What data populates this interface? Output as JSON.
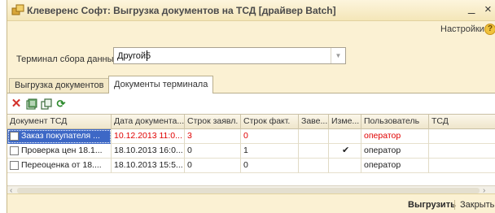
{
  "window": {
    "title": "Клеверенс Софт: Выгрузка документов на ТСД [драйвер Batch]",
    "minimize_glyph": "_",
    "maximize_glyph": "□",
    "close_glyph": "×",
    "settings_label": "Настройки",
    "help_glyph": "?"
  },
  "terminal": {
    "label": "Терминал сбора данных:",
    "value": "Другой5"
  },
  "tabs": [
    {
      "label": "Выгрузка документов",
      "active": false
    },
    {
      "label": "Документы терминала",
      "active": true
    }
  ],
  "toolbar": {
    "icons": [
      "delete-icon",
      "edit-icon",
      "copy-icon",
      "refresh-icon"
    ]
  },
  "table": {
    "columns": [
      "Документ ТСД",
      "Дата документа...",
      "Строк заявл.",
      "Строк факт.",
      "Заве...",
      "Изме...",
      "Пользователь",
      "ТСД"
    ],
    "rows": [
      {
        "doc": "Заказ покупателя ...",
        "date": "10.12.2013 11:0...",
        "planned": "3",
        "actual": "0",
        "completed": "",
        "changed": "",
        "user": "оператор",
        "tsd": "",
        "highlight": true,
        "selected": true
      },
      {
        "doc": "Проверка цен 18.1...",
        "date": "18.10.2013 16:0...",
        "planned": "0",
        "actual": "1",
        "completed": "",
        "changed": "✔",
        "user": "оператор",
        "tsd": "",
        "highlight": false,
        "selected": false
      },
      {
        "doc": "Переоценка от 18....",
        "date": "18.10.2013 15:5...",
        "planned": "0",
        "actual": "0",
        "completed": "",
        "changed": "",
        "user": "оператор",
        "tsd": "",
        "highlight": false,
        "selected": false
      }
    ]
  },
  "footer": {
    "upload_label": "Выгрузить",
    "close_label": "Закрыть"
  },
  "colors": {
    "window_bg": "#fbf1d3",
    "highlight_text": "#e00000",
    "selection": "#3d68c6"
  }
}
